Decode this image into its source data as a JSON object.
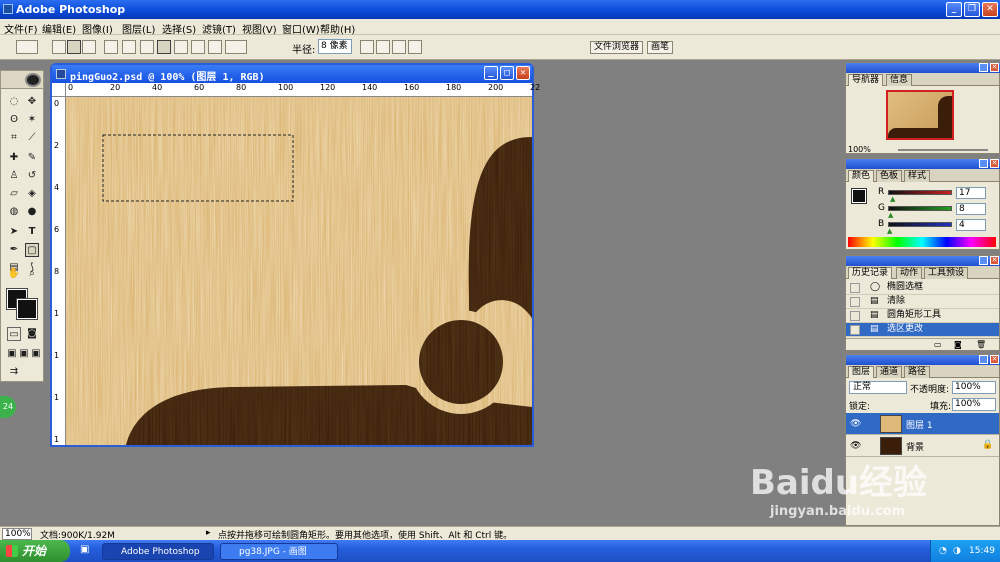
{
  "app": {
    "title": "Adobe Photoshop"
  },
  "menu": [
    "文件(F)",
    "编辑(E)",
    "图像(I)",
    "图层(L)",
    "选择(S)",
    "滤镜(T)",
    "视图(V)",
    "窗口(W)",
    "帮助(H)"
  ],
  "options": {
    "radius_label": "半径:",
    "radius_value": "8 像素",
    "well_tabs": [
      "文件浏览器",
      "画笔"
    ]
  },
  "document": {
    "title": "pingGuo2.psd @ 100% (图层 1, RGB)",
    "ruler_ticks_top": [
      "0",
      "20",
      "40",
      "60",
      "80",
      "100",
      "120",
      "140",
      "160",
      "180",
      "200",
      "22"
    ],
    "ruler_ticks_left": [
      "0",
      "2",
      "4",
      "6",
      "8",
      "1",
      "1",
      "1",
      "1"
    ]
  },
  "navigator": {
    "tabs": [
      "导航器",
      "信息"
    ],
    "zoom": "100%"
  },
  "color_panel": {
    "tabs": [
      "颜色",
      "色板",
      "样式"
    ],
    "channels": [
      {
        "label": "R",
        "value": "17",
        "fraction": 0.067,
        "color": "#cc2020"
      },
      {
        "label": "G",
        "value": "8",
        "fraction": 0.031,
        "color": "#20a020"
      },
      {
        "label": "B",
        "value": "4",
        "fraction": 0.016,
        "color": "#2030c0"
      }
    ]
  },
  "history_panel": {
    "tabs": [
      "历史记录",
      "动作",
      "工具预设"
    ],
    "items": [
      "椭圆选框",
      "清除",
      "圆角矩形工具",
      "选区更改"
    ],
    "selected_index": 3
  },
  "layers_panel": {
    "tabs": [
      "图层",
      "通道",
      "路径"
    ],
    "blend_mode": "正常",
    "opacity_label": "不透明度:",
    "opacity_value": "100%",
    "lock_label": "锁定:",
    "fill_label": "填充:",
    "fill_value": "100%",
    "layers": [
      {
        "name": "图层 1",
        "selected": true
      },
      {
        "name": "背景",
        "selected": false
      }
    ]
  },
  "status": {
    "zoom": "100%",
    "doc_info": "文档:900K/1.92M",
    "hint": "点按并拖移可绘制圆角矩形。要用其他选项，使用 Shift、Alt 和 Ctrl 键。"
  },
  "taskbar": {
    "start_label": "开始",
    "tasks": [
      "Adobe Photoshop",
      "pg38.JPG - 画图"
    ],
    "clock": "15:49"
  },
  "watermark": {
    "logo": "Baidu经验",
    "url": "jingyan.baidu.com"
  },
  "colors": {
    "wood_light": "#ddb878",
    "wood_dark": "#3a1e0a",
    "xp_blue": "#245edc",
    "selection_blue": "#316ac5"
  }
}
